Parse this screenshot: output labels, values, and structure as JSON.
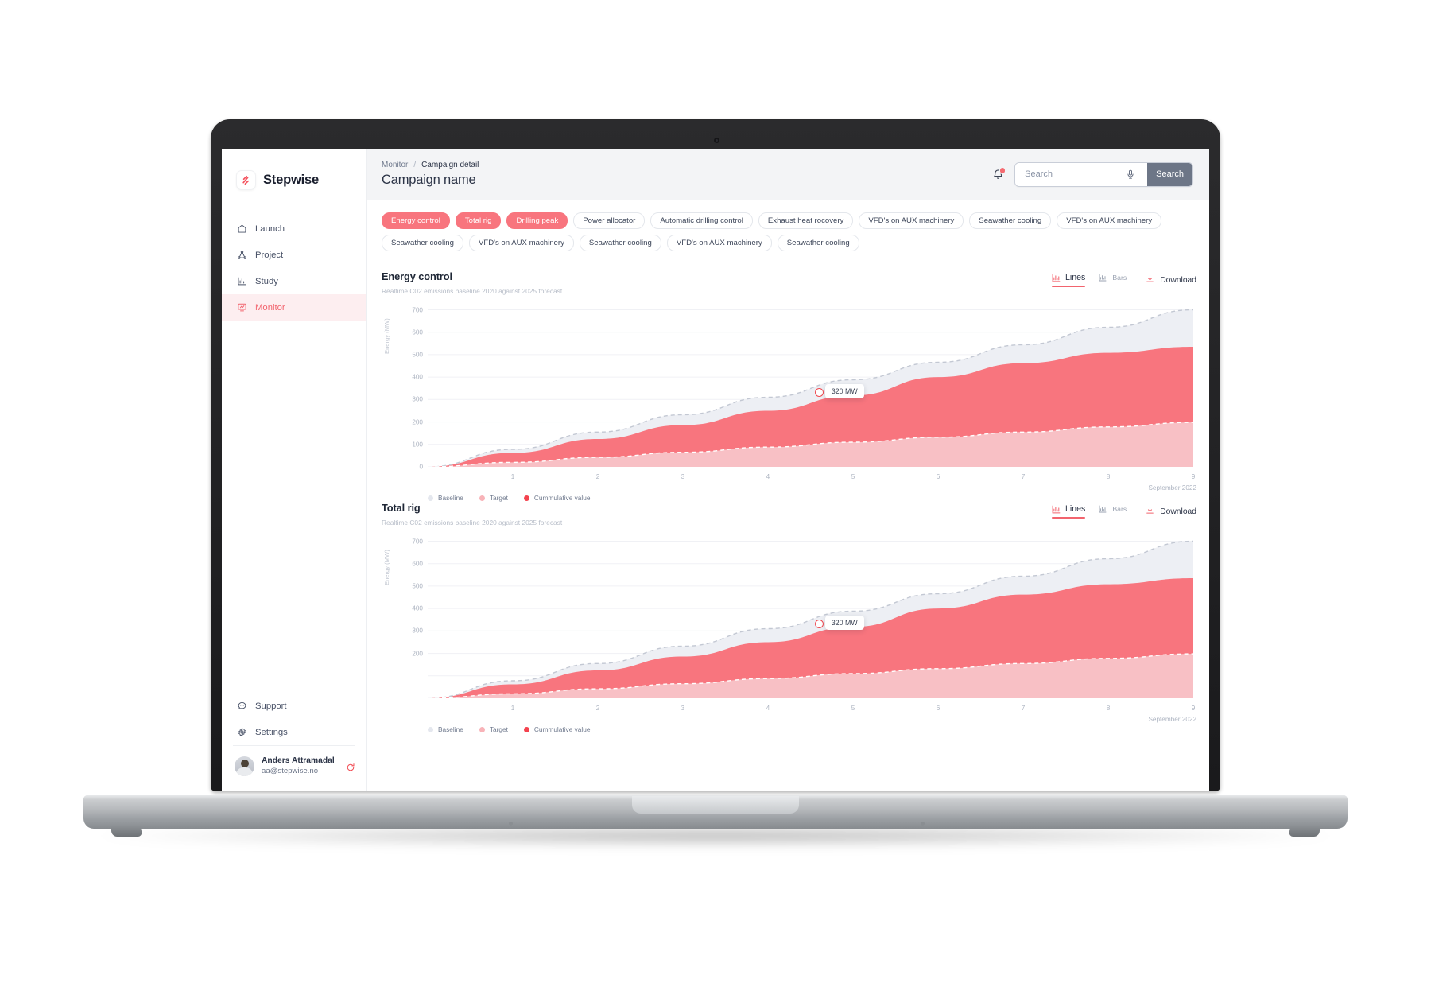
{
  "brand": {
    "name": "Stepwise",
    "logo_icon": "stepwise-logo-icon"
  },
  "sidebar": {
    "items": [
      {
        "label": "Launch",
        "icon": "home-icon",
        "active": false
      },
      {
        "label": "Project",
        "icon": "project-node-icon",
        "active": false
      },
      {
        "label": "Study",
        "icon": "bar-chart-icon",
        "active": false
      },
      {
        "label": "Monitor",
        "icon": "monitor-screen-icon",
        "active": true
      }
    ],
    "bottom_items": [
      {
        "label": "Support",
        "icon": "chat-help-icon"
      },
      {
        "label": "Settings",
        "icon": "gear-icon"
      }
    ],
    "user": {
      "name": "Anders Attramadal",
      "email": "aa@stepwise.no",
      "avatar_icon": "user-avatar",
      "logout_icon": "logout-icon"
    }
  },
  "topbar": {
    "breadcrumb": {
      "parent": "Monitor",
      "separator": "/",
      "current": "Campaign detail"
    },
    "page_title": "Campaign name",
    "notification": {
      "icon": "bell-icon",
      "has_badge": true
    },
    "search": {
      "placeholder": "Search",
      "value": "",
      "mic_icon": "microphone-icon",
      "button_label": "Search"
    }
  },
  "filters": {
    "pills": [
      {
        "label": "Energy control",
        "selected": true
      },
      {
        "label": "Total rig",
        "selected": true
      },
      {
        "label": "Drilling peak",
        "selected": true
      },
      {
        "label": "Power allocator",
        "selected": false
      },
      {
        "label": "Automatic drilling control",
        "selected": false
      },
      {
        "label": "Exhaust heat rocovery",
        "selected": false
      },
      {
        "label": "VFD's on AUX machinery",
        "selected": false
      },
      {
        "label": "Seawather cooling",
        "selected": false
      },
      {
        "label": "VFD's on AUX machinery",
        "selected": false
      },
      {
        "label": "Seawather cooling",
        "selected": false
      },
      {
        "label": "VFD's on AUX machinery",
        "selected": false
      },
      {
        "label": "Seawather cooling",
        "selected": false
      },
      {
        "label": "VFD's on AUX machinery",
        "selected": false
      },
      {
        "label": "Seawather cooling",
        "selected": false
      }
    ]
  },
  "charts": [
    {
      "title": "Energy control",
      "subtitle": "Realtime C02 emissions baseline 2020 against 2025 forecast",
      "tools": {
        "lines_label": "Lines",
        "lines_icon": "line-chart-icon",
        "lines_active": true,
        "bars_label": "Bars",
        "bars_icon": "bar-chart-icon",
        "bars_active": false,
        "download_label": "Download",
        "download_icon": "download-icon"
      },
      "marker": {
        "label": "320 MW",
        "x_index": 4.55,
        "y_value": 350
      }
    },
    {
      "title": "Total rig",
      "subtitle": "Realtime C02 emissions baseline 2020 against 2025 forecast",
      "tools": {
        "lines_label": "Lines",
        "lines_icon": "line-chart-icon",
        "lines_active": true,
        "bars_label": "Bars",
        "bars_icon": "bar-chart-icon",
        "bars_active": false,
        "download_label": "Download",
        "download_icon": "download-icon"
      },
      "marker": {
        "label": "320 MW",
        "x_index": 4.55,
        "y_value": 350
      }
    }
  ],
  "chart_data": [
    {
      "type": "area",
      "title": "Energy control",
      "subtitle": "Realtime C02 emissions baseline 2020 against 2025 forecast",
      "xlabel": "September 2022",
      "ylabel": "Energy (MW)",
      "x": [
        0,
        1,
        2,
        3,
        4,
        5,
        6,
        7,
        8,
        9
      ],
      "xticks": [
        "1",
        "2",
        "3",
        "4",
        "5",
        "6",
        "7",
        "8",
        "9"
      ],
      "yticks": [
        0,
        100,
        200,
        300,
        400,
        500,
        600,
        700
      ],
      "ylim": [
        0,
        730
      ],
      "grid": true,
      "legend_position": "bottom-left",
      "series": [
        {
          "name": "Baseline",
          "color": "#e9ebf0",
          "line_style": "dashed",
          "values": [
            0,
            78,
            155,
            232,
            310,
            388,
            466,
            544,
            622,
            700
          ]
        },
        {
          "name": "Cummulative value",
          "color": "#f8757e",
          "line_style": "solid",
          "values": [
            0,
            62,
            124,
            186,
            250,
            318,
            400,
            462,
            508,
            535
          ]
        },
        {
          "name": "Target",
          "color": "#f6b7bc",
          "line_style": "dashed",
          "values": [
            0,
            20,
            42,
            65,
            88,
            110,
            132,
            155,
            178,
            198
          ]
        }
      ],
      "annotation": {
        "label": "320 MW",
        "x": 4.55,
        "y": 350
      }
    },
    {
      "type": "area",
      "title": "Total rig",
      "subtitle": "Realtime C02 emissions baseline 2020 against 2025 forecast",
      "xlabel": "September 2022",
      "ylabel": "Energy (MW)",
      "x": [
        0,
        1,
        2,
        3,
        4,
        5,
        6,
        7,
        8,
        9
      ],
      "xticks": [
        "1",
        "2",
        "3",
        "4",
        "5",
        "6",
        "7",
        "8",
        "9"
      ],
      "yticks": [
        200,
        300,
        400,
        500,
        600,
        700
      ],
      "ylim": [
        0,
        730
      ],
      "grid": true,
      "legend_position": "bottom-left",
      "series": [
        {
          "name": "Baseline",
          "color": "#e9ebf0",
          "line_style": "dashed",
          "values": [
            0,
            78,
            155,
            232,
            310,
            388,
            466,
            544,
            622,
            700
          ]
        },
        {
          "name": "Cummulative value",
          "color": "#f8757e",
          "line_style": "solid",
          "values": [
            0,
            62,
            124,
            186,
            250,
            318,
            400,
            462,
            508,
            535
          ]
        },
        {
          "name": "Target",
          "color": "#f6b7bc",
          "line_style": "dashed",
          "values": [
            0,
            20,
            42,
            65,
            88,
            110,
            132,
            155,
            178,
            198
          ]
        }
      ],
      "annotation": {
        "label": "320 MW",
        "x": 4.55,
        "y": 350
      }
    }
  ],
  "legend": [
    {
      "label": "Baseline",
      "color": "#e4e7ee"
    },
    {
      "label": "Target",
      "color": "#f8b3b8"
    },
    {
      "label": "Cummulative value",
      "color": "#f4434f"
    }
  ],
  "colors": {
    "accent": "#f2646e",
    "accent_pill": "#f8757e",
    "text": "#2c3447",
    "muted": "#aeb5c2",
    "baseline_fill": "#eceef3",
    "target_fill": "#f6c4c8",
    "cumulative_fill": "#f8757e"
  }
}
